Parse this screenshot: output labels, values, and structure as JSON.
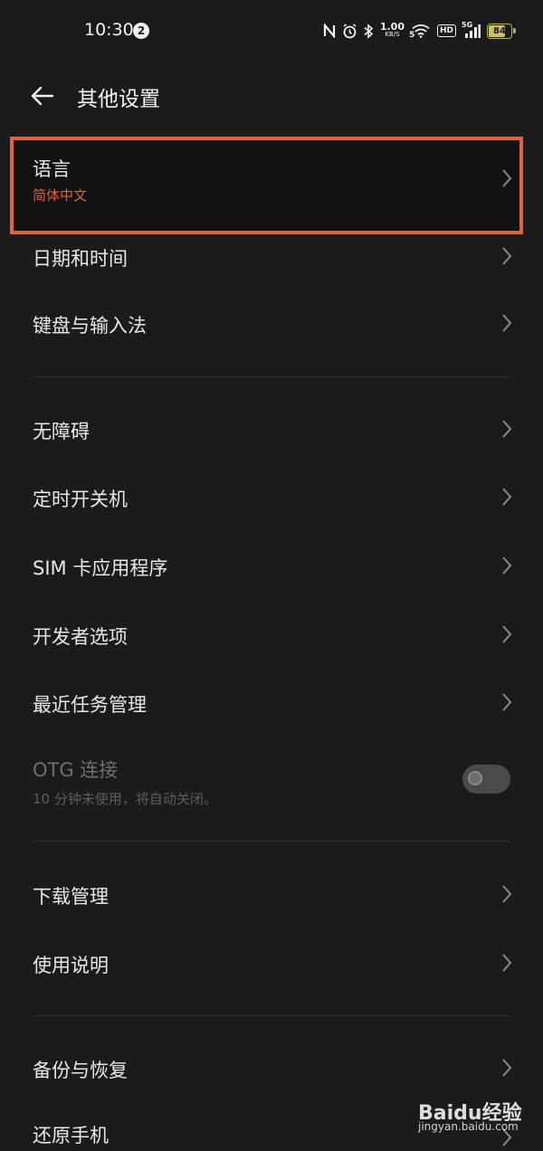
{
  "status_bar": {
    "time": "10:30",
    "notification_count": "2",
    "net_speed_value": "1.00",
    "net_speed_unit": "KB/S",
    "wifi_generation": "5",
    "hd_label": "HD",
    "cellular_label": "5G",
    "battery_level": "84",
    "battery_fraction": 0.84
  },
  "header": {
    "title": "其他设置"
  },
  "settings": {
    "language": {
      "label": "语言",
      "value": "简体中文"
    },
    "datetime": {
      "label": "日期和时间"
    },
    "keyboard": {
      "label": "键盘与输入法"
    },
    "accessibility": {
      "label": "无障碍"
    },
    "scheduled_power": {
      "label": "定时开关机"
    },
    "sim_apps": {
      "label": "SIM 卡应用程序"
    },
    "developer": {
      "label": "开发者选项"
    },
    "recent_tasks": {
      "label": "最近任务管理"
    },
    "otg": {
      "label": "OTG 连接",
      "description": "10 分钟未使用，将自动关闭。",
      "enabled": false
    },
    "downloads": {
      "label": "下载管理"
    },
    "instructions": {
      "label": "使用说明"
    },
    "backup": {
      "label": "备份与恢复"
    },
    "reset": {
      "label": "还原手机"
    }
  },
  "watermark": {
    "text": "Baidu经验",
    "url": "jingyan.baidu.com"
  },
  "colors": {
    "background": "#1b1b1b",
    "highlight_border": "#e0653e",
    "accent_text": "#e06040"
  }
}
